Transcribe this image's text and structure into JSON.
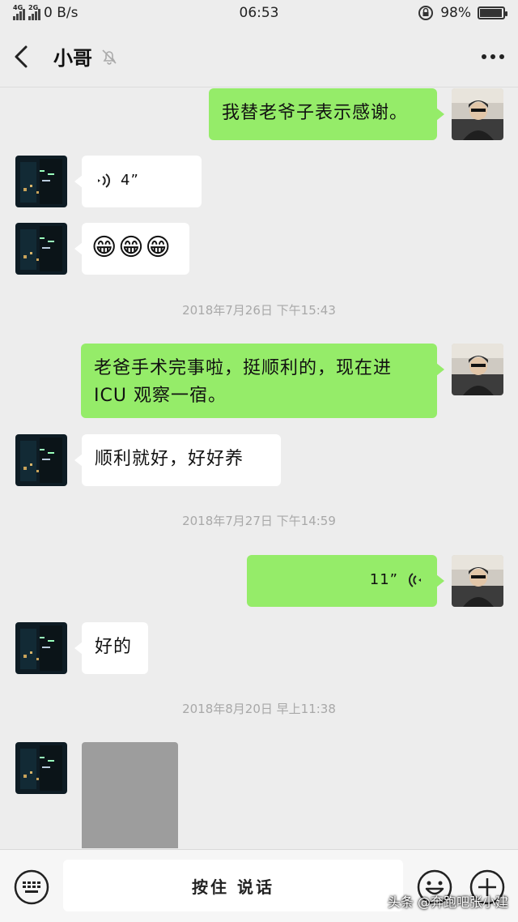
{
  "status_bar": {
    "network_1": "4G",
    "network_2": "2G",
    "speed": "0 B/s",
    "time": "06:53",
    "battery": "98%",
    "battery_level": 0.98
  },
  "header": {
    "title": "小哥"
  },
  "messages": {
    "m1": "我替老爷子表示感谢。",
    "m2_duration": "4”",
    "m3": "😁😁😁",
    "ts1": "2018年7月26日 下午15:43",
    "m4": "老爸手术完事啦，挺顺利的，现在进 ICU 观察一宿。",
    "m5": "顺利就好，好好养",
    "ts2": "2018年7月27日 下午14:59",
    "m6_duration": "11”",
    "m7": "好的",
    "ts3": "2018年8月20日 早上11:38"
  },
  "input": {
    "hold_to_talk": "按住 说话"
  },
  "watermark": "头条 @奔跑吧张小建",
  "colors": {
    "sent_bubble": "#95ec69",
    "received_bubble": "#ffffff",
    "background": "#ededed"
  }
}
